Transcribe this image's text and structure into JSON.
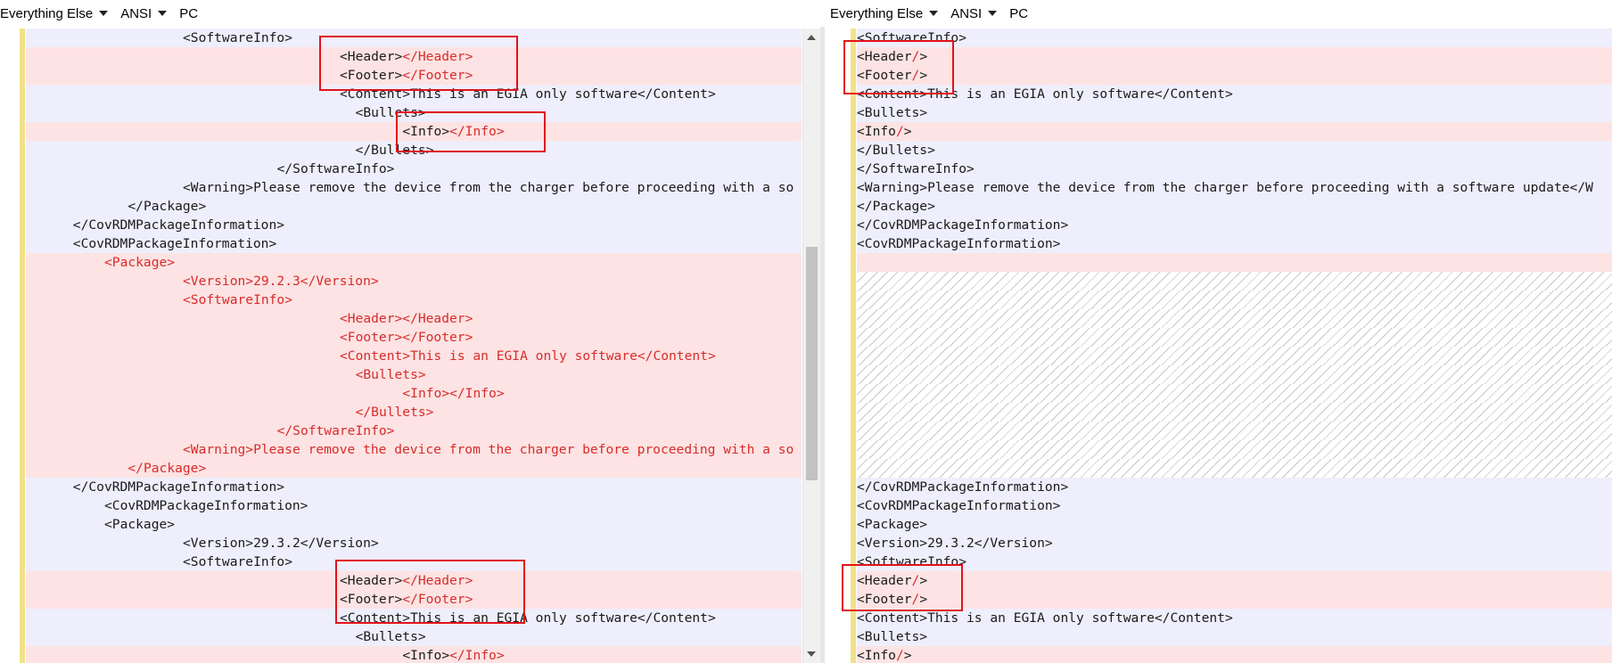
{
  "left_toolbar": {
    "format": "Everything Else",
    "encoding": "ANSI",
    "line_endings": "PC"
  },
  "right_toolbar": {
    "format": "Everything Else",
    "encoding": "ANSI",
    "line_endings": "PC"
  },
  "left_lines": [
    {
      "t": "same",
      "indent": 20,
      "parts": [
        {
          "s": "<SoftwareInfo>"
        }
      ]
    },
    {
      "t": "diff",
      "indent": 40,
      "parts": [
        {
          "s": "<Header>"
        },
        {
          "s": "</Header>",
          "r": 1
        }
      ]
    },
    {
      "t": "diff",
      "indent": 40,
      "parts": [
        {
          "s": "<Footer>"
        },
        {
          "s": "</Footer>",
          "r": 1
        }
      ]
    },
    {
      "t": "same",
      "indent": 40,
      "parts": [
        {
          "s": "<Content>This is an EGIA only software</Content>"
        }
      ]
    },
    {
      "t": "same",
      "indent": 42,
      "parts": [
        {
          "s": "<Bullets>"
        }
      ]
    },
    {
      "t": "diff",
      "indent": 48,
      "parts": [
        {
          "s": "<Info>"
        },
        {
          "s": "</Info>",
          "r": 1
        }
      ]
    },
    {
      "t": "same",
      "indent": 42,
      "parts": [
        {
          "s": "</Bullets>"
        }
      ]
    },
    {
      "t": "same",
      "indent": 32,
      "parts": [
        {
          "s": "</SoftwareInfo>"
        }
      ]
    },
    {
      "t": "same",
      "indent": 20,
      "parts": [
        {
          "s": "<Warning>Please remove the device from the charger before proceeding with a so"
        }
      ]
    },
    {
      "t": "same",
      "indent": 13,
      "parts": [
        {
          "s": "</Package>"
        }
      ]
    },
    {
      "t": "same",
      "indent": 6,
      "parts": [
        {
          "s": "</CovRDMPackageInformation>"
        }
      ]
    },
    {
      "t": "same",
      "indent": 6,
      "parts": [
        {
          "s": "<CovRDMPackageInformation>"
        }
      ]
    },
    {
      "t": "diff",
      "indent": 10,
      "parts": [
        {
          "s": "<Package>",
          "r": 1
        }
      ]
    },
    {
      "t": "diff",
      "indent": 20,
      "parts": [
        {
          "s": "<Version>29.2.3</Version>",
          "r": 1
        }
      ]
    },
    {
      "t": "diff",
      "indent": 20,
      "parts": [
        {
          "s": "<SoftwareInfo>",
          "r": 1
        }
      ]
    },
    {
      "t": "diff",
      "indent": 40,
      "parts": [
        {
          "s": "<Header></Header>",
          "r": 1
        }
      ]
    },
    {
      "t": "diff",
      "indent": 40,
      "parts": [
        {
          "s": "<Footer></Footer>",
          "r": 1
        }
      ]
    },
    {
      "t": "diff",
      "indent": 40,
      "parts": [
        {
          "s": "<Content>This is an EGIA only software</Content>",
          "r": 1
        }
      ]
    },
    {
      "t": "diff",
      "indent": 42,
      "parts": [
        {
          "s": "<Bullets>",
          "r": 1
        }
      ]
    },
    {
      "t": "diff",
      "indent": 48,
      "parts": [
        {
          "s": "<Info></Info>",
          "r": 1
        }
      ]
    },
    {
      "t": "diff",
      "indent": 42,
      "parts": [
        {
          "s": "</Bullets>",
          "r": 1
        }
      ]
    },
    {
      "t": "diff",
      "indent": 32,
      "parts": [
        {
          "s": "</SoftwareInfo>",
          "r": 1
        }
      ]
    },
    {
      "t": "diff",
      "indent": 20,
      "parts": [
        {
          "s": "<Warning>Please remove the device from the charger before proceeding with a so",
          "r": 1
        }
      ]
    },
    {
      "t": "diff",
      "indent": 13,
      "parts": [
        {
          "s": "</Package>",
          "r": 1
        }
      ]
    },
    {
      "t": "same",
      "indent": 6,
      "parts": [
        {
          "s": "</CovRDMPackageInformation>"
        }
      ]
    },
    {
      "t": "same",
      "indent": 10,
      "parts": [
        {
          "s": "<CovRDMPackageInformation>"
        }
      ]
    },
    {
      "t": "same",
      "indent": 10,
      "parts": [
        {
          "s": "<Package>"
        }
      ]
    },
    {
      "t": "same",
      "indent": 20,
      "parts": [
        {
          "s": "<Version>29.3.2</Version>"
        }
      ]
    },
    {
      "t": "same",
      "indent": 20,
      "parts": [
        {
          "s": "<SoftwareInfo>"
        }
      ]
    },
    {
      "t": "diff",
      "indent": 40,
      "parts": [
        {
          "s": "<Header>"
        },
        {
          "s": "</Header>",
          "r": 1
        }
      ]
    },
    {
      "t": "diff",
      "indent": 40,
      "parts": [
        {
          "s": "<Footer>"
        },
        {
          "s": "</Footer>",
          "r": 1
        }
      ]
    },
    {
      "t": "same",
      "indent": 40,
      "parts": [
        {
          "s": "<Content>This is an EGIA only software</Content>"
        }
      ]
    },
    {
      "t": "same",
      "indent": 42,
      "parts": [
        {
          "s": "<Bullets>"
        }
      ]
    },
    {
      "t": "diff",
      "indent": 48,
      "parts": [
        {
          "s": "<Info>"
        },
        {
          "s": "</Info>",
          "r": 1
        }
      ]
    }
  ],
  "right_lines": [
    {
      "t": "same",
      "indent": 0,
      "parts": [
        {
          "s": "<SoftwareInfo>"
        }
      ]
    },
    {
      "t": "diff",
      "indent": 0,
      "parts": [
        {
          "s": "<Header"
        },
        {
          "s": "/",
          "r": 1
        },
        {
          "s": ">"
        }
      ]
    },
    {
      "t": "diff",
      "indent": 0,
      "parts": [
        {
          "s": "<Footer"
        },
        {
          "s": "/",
          "r": 1
        },
        {
          "s": ">"
        }
      ]
    },
    {
      "t": "same",
      "indent": 0,
      "parts": [
        {
          "s": "<Content>This is an EGIA only software</Content>"
        }
      ]
    },
    {
      "t": "same",
      "indent": 0,
      "parts": [
        {
          "s": "<Bullets>"
        }
      ]
    },
    {
      "t": "diff",
      "indent": 0,
      "parts": [
        {
          "s": "<Info"
        },
        {
          "s": "/",
          "r": 1
        },
        {
          "s": ">"
        }
      ]
    },
    {
      "t": "same",
      "indent": 0,
      "parts": [
        {
          "s": "</Bullets>"
        }
      ]
    },
    {
      "t": "same",
      "indent": 0,
      "parts": [
        {
          "s": "</SoftwareInfo>"
        }
      ]
    },
    {
      "t": "same",
      "indent": 0,
      "parts": [
        {
          "s": "<Warning>Please remove the device from the charger before proceeding with a software update</W"
        }
      ]
    },
    {
      "t": "same",
      "indent": 0,
      "parts": [
        {
          "s": "</Package>"
        }
      ]
    },
    {
      "t": "same",
      "indent": 0,
      "parts": [
        {
          "s": "</CovRDMPackageInformation>"
        }
      ]
    },
    {
      "t": "same",
      "indent": 0,
      "parts": [
        {
          "s": "<CovRDMPackageInformation>"
        }
      ]
    },
    {
      "t": "diff",
      "indent": 0,
      "parts": []
    },
    {
      "t": "filler",
      "indent": 0,
      "parts": []
    },
    {
      "t": "filler",
      "indent": 0,
      "parts": []
    },
    {
      "t": "filler",
      "indent": 0,
      "parts": []
    },
    {
      "t": "filler",
      "indent": 0,
      "parts": []
    },
    {
      "t": "filler",
      "indent": 0,
      "parts": []
    },
    {
      "t": "filler",
      "indent": 0,
      "parts": []
    },
    {
      "t": "filler",
      "indent": 0,
      "parts": []
    },
    {
      "t": "filler",
      "indent": 0,
      "parts": []
    },
    {
      "t": "filler",
      "indent": 0,
      "parts": []
    },
    {
      "t": "filler",
      "indent": 0,
      "parts": []
    },
    {
      "t": "filler",
      "indent": 0,
      "parts": []
    },
    {
      "t": "same",
      "indent": 0,
      "parts": [
        {
          "s": "</CovRDMPackageInformation>"
        }
      ]
    },
    {
      "t": "same",
      "indent": 0,
      "parts": [
        {
          "s": "<CovRDMPackageInformation>"
        }
      ]
    },
    {
      "t": "same",
      "indent": 0,
      "parts": [
        {
          "s": "<Package>"
        }
      ]
    },
    {
      "t": "same",
      "indent": 0,
      "parts": [
        {
          "s": "<Version>29.3.2</Version>"
        }
      ]
    },
    {
      "t": "same",
      "indent": 0,
      "parts": [
        {
          "s": "<SoftwareInfo>"
        }
      ]
    },
    {
      "t": "diff",
      "indent": 0,
      "parts": [
        {
          "s": "<Header"
        },
        {
          "s": "/",
          "r": 1
        },
        {
          "s": ">"
        }
      ]
    },
    {
      "t": "diff",
      "indent": 0,
      "parts": [
        {
          "s": "<Footer"
        },
        {
          "s": "/",
          "r": 1
        },
        {
          "s": ">"
        }
      ]
    },
    {
      "t": "same",
      "indent": 0,
      "parts": [
        {
          "s": "<Content>This is an EGIA only software</Content>"
        }
      ]
    },
    {
      "t": "same",
      "indent": 0,
      "parts": [
        {
          "s": "<Bullets>"
        }
      ]
    },
    {
      "t": "diff",
      "indent": 0,
      "parts": [
        {
          "s": "<Info"
        },
        {
          "s": "/",
          "r": 1
        },
        {
          "s": ">"
        }
      ]
    }
  ],
  "colors": {
    "same_bg": "#eeeefc",
    "diff_bg": "#fde3e3",
    "change_text": "#d92b2b",
    "marker_bar": "#f1e18a",
    "annotation_box": "#e2121b"
  }
}
